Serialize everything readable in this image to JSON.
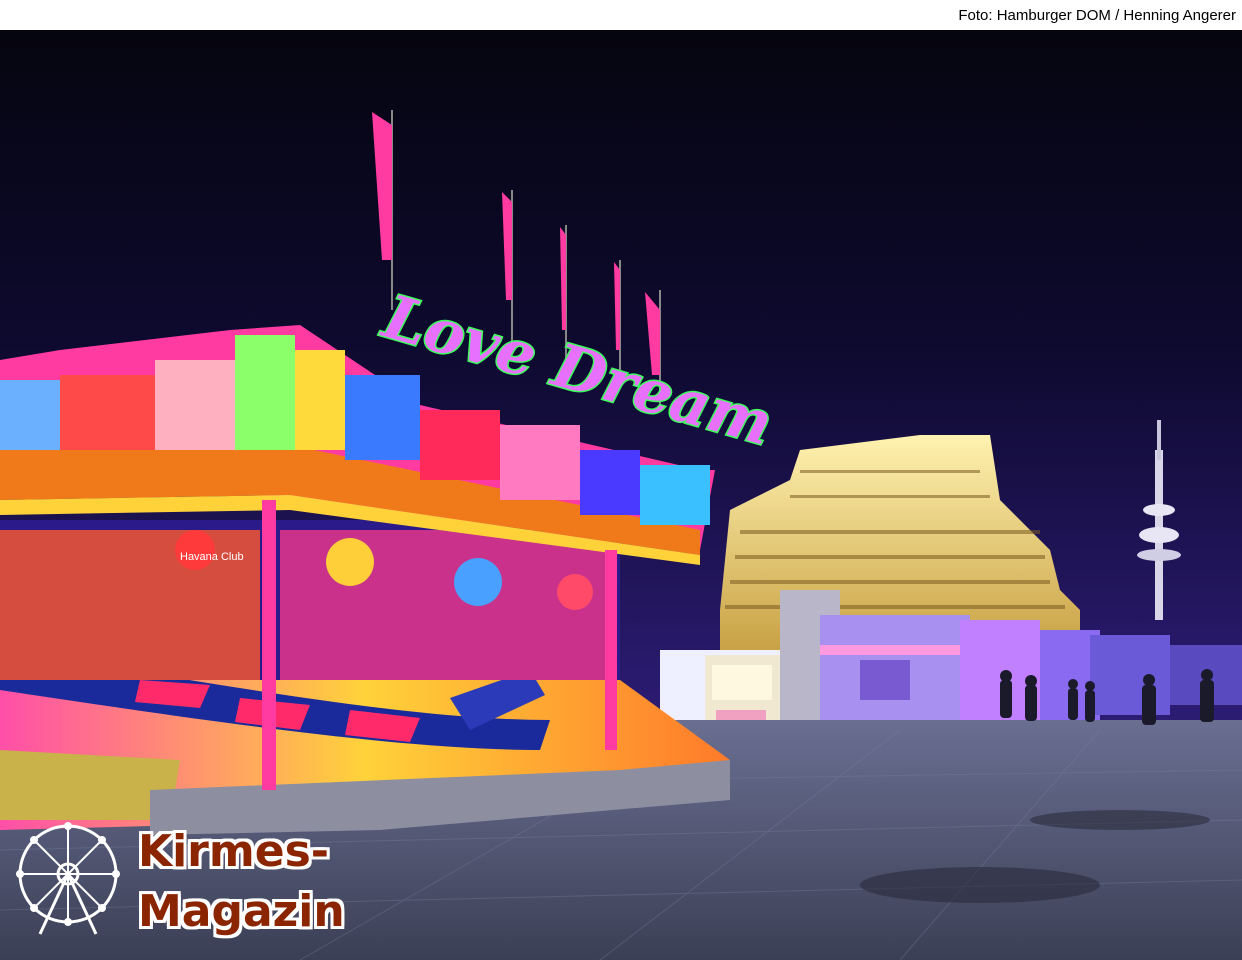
{
  "photo_credit": "Foto: Hamburger DOM / Henning Angerer",
  "ride_sign": "Love Dream",
  "booth_sign": "Havana Club",
  "logo": {
    "line1": "Kirmes-",
    "line2": "Magazin",
    "color": "#8b2500",
    "icon": "ferris-wheel-icon"
  },
  "colors": {
    "sky": "#120a3a",
    "ride_frame": "#f07a1a",
    "neon_green": "#3cff5a",
    "pavement": "#5a5e78"
  }
}
